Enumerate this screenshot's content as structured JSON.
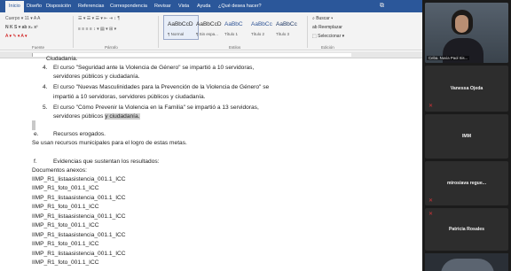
{
  "ribbon": {
    "tabs": [
      "Inicio",
      "Diseño",
      "Disposición",
      "Referencias",
      "Correspondencia",
      "Revisar",
      "Vista",
      "Ayuda",
      "¿Qué desea hacer?"
    ],
    "active_tab_index": 0,
    "font_row": "Cuerpo ▾  11 ▾  A  A",
    "format_row": "N  K  S ▾  ab  x₂  x²",
    "color_row": "A ▾  ✎ ▾  A ▾",
    "para_row1": "☰ ▾  ☰ ▾  ☰ ▾   ⇤  ⇥   ↕  ¶",
    "para_row2": "≡  ≡  ≡  ≡   ↕ ▾   ▤ ▾  ⊞ ▾",
    "groups": {
      "font": "Fuente",
      "paragraph": "Párrafo",
      "styles": "Estilos",
      "editing": "Edición"
    },
    "styles": [
      {
        "sample": "AaBbCcD",
        "name": "¶ Normal"
      },
      {
        "sample": "AaBbCcD",
        "name": "¶ Sin espa..."
      },
      {
        "sample": "AaBbC",
        "name": "Título 1"
      },
      {
        "sample": "AaBbCc",
        "name": "Título 2"
      },
      {
        "sample": "AaBbCc",
        "name": "Título 3"
      }
    ],
    "editing": [
      "⌕ Buscar ▾",
      "ab Reemplazar",
      "⬚ Seleccionar ▾"
    ]
  },
  "document": {
    "top_cut": "Ciudadanía.",
    "items": [
      {
        "num": "4.",
        "line1": "El curso \"Seguridad ante la Violencia de Género\" se impartió a 10 servidoras,",
        "line2": "servidores públicos y ciudadanía."
      },
      {
        "num": "4.",
        "line1": "El curso \"Nuevas Masculinidades para la Prevención de la Violencia de Género\" se",
        "line2": "impartió a 10 servidoras, servidores públicos y ciudadanía."
      },
      {
        "num": "5.",
        "line1": "El curso \"Cómo Prevenir la Violencia en la Familia\" se impartió a 13 servidoras,",
        "line2a": "servidores públicos ",
        "line2b": "y ciudadanía."
      }
    ],
    "section_e": {
      "letter": "e.",
      "title": "Recursos erogados."
    },
    "section_e_body": "Se usan recursos municipales para el logro de estas metas.",
    "section_f": {
      "letter": "f.",
      "title": "Evidencias que sustentan los resultados:"
    },
    "annex_heading": "Documentos anexos:",
    "annexes": [
      "IIMP_R1_listaasistencia_001.1_ICC",
      "IIMP_R1_foto_001.1_ICC",
      "IIMP_R1_listaasistencia_001.1_ICC",
      "IIMP_R1_foto_001.1_ICC",
      "IIMP_R1_listaasistencia_001.1_ICC",
      "IIMP_R1_foto_001.1_ICC",
      "IIMP_R1_listaasistencia_001.1_ICC",
      "IIMP_R1_foto_001.1_ICC",
      "IIMP_R1_listaasistencia_001.1_ICC",
      "IIMP_R1_foto_001.1_ICC"
    ]
  },
  "teams": {
    "self_name": "Ceba. Nuvia Paol Sis...",
    "participants": [
      "Vanessa Ojeda",
      "IMM",
      "mirosiava regue...",
      "Patricia Rosales"
    ]
  },
  "colors": {
    "word_blue": "#2b579a",
    "ribbon_bg": "#f3f3f3",
    "teams_bg": "#1b1b1b",
    "tile_bg": "#2d2d2d",
    "mic_red": "#d13438"
  }
}
